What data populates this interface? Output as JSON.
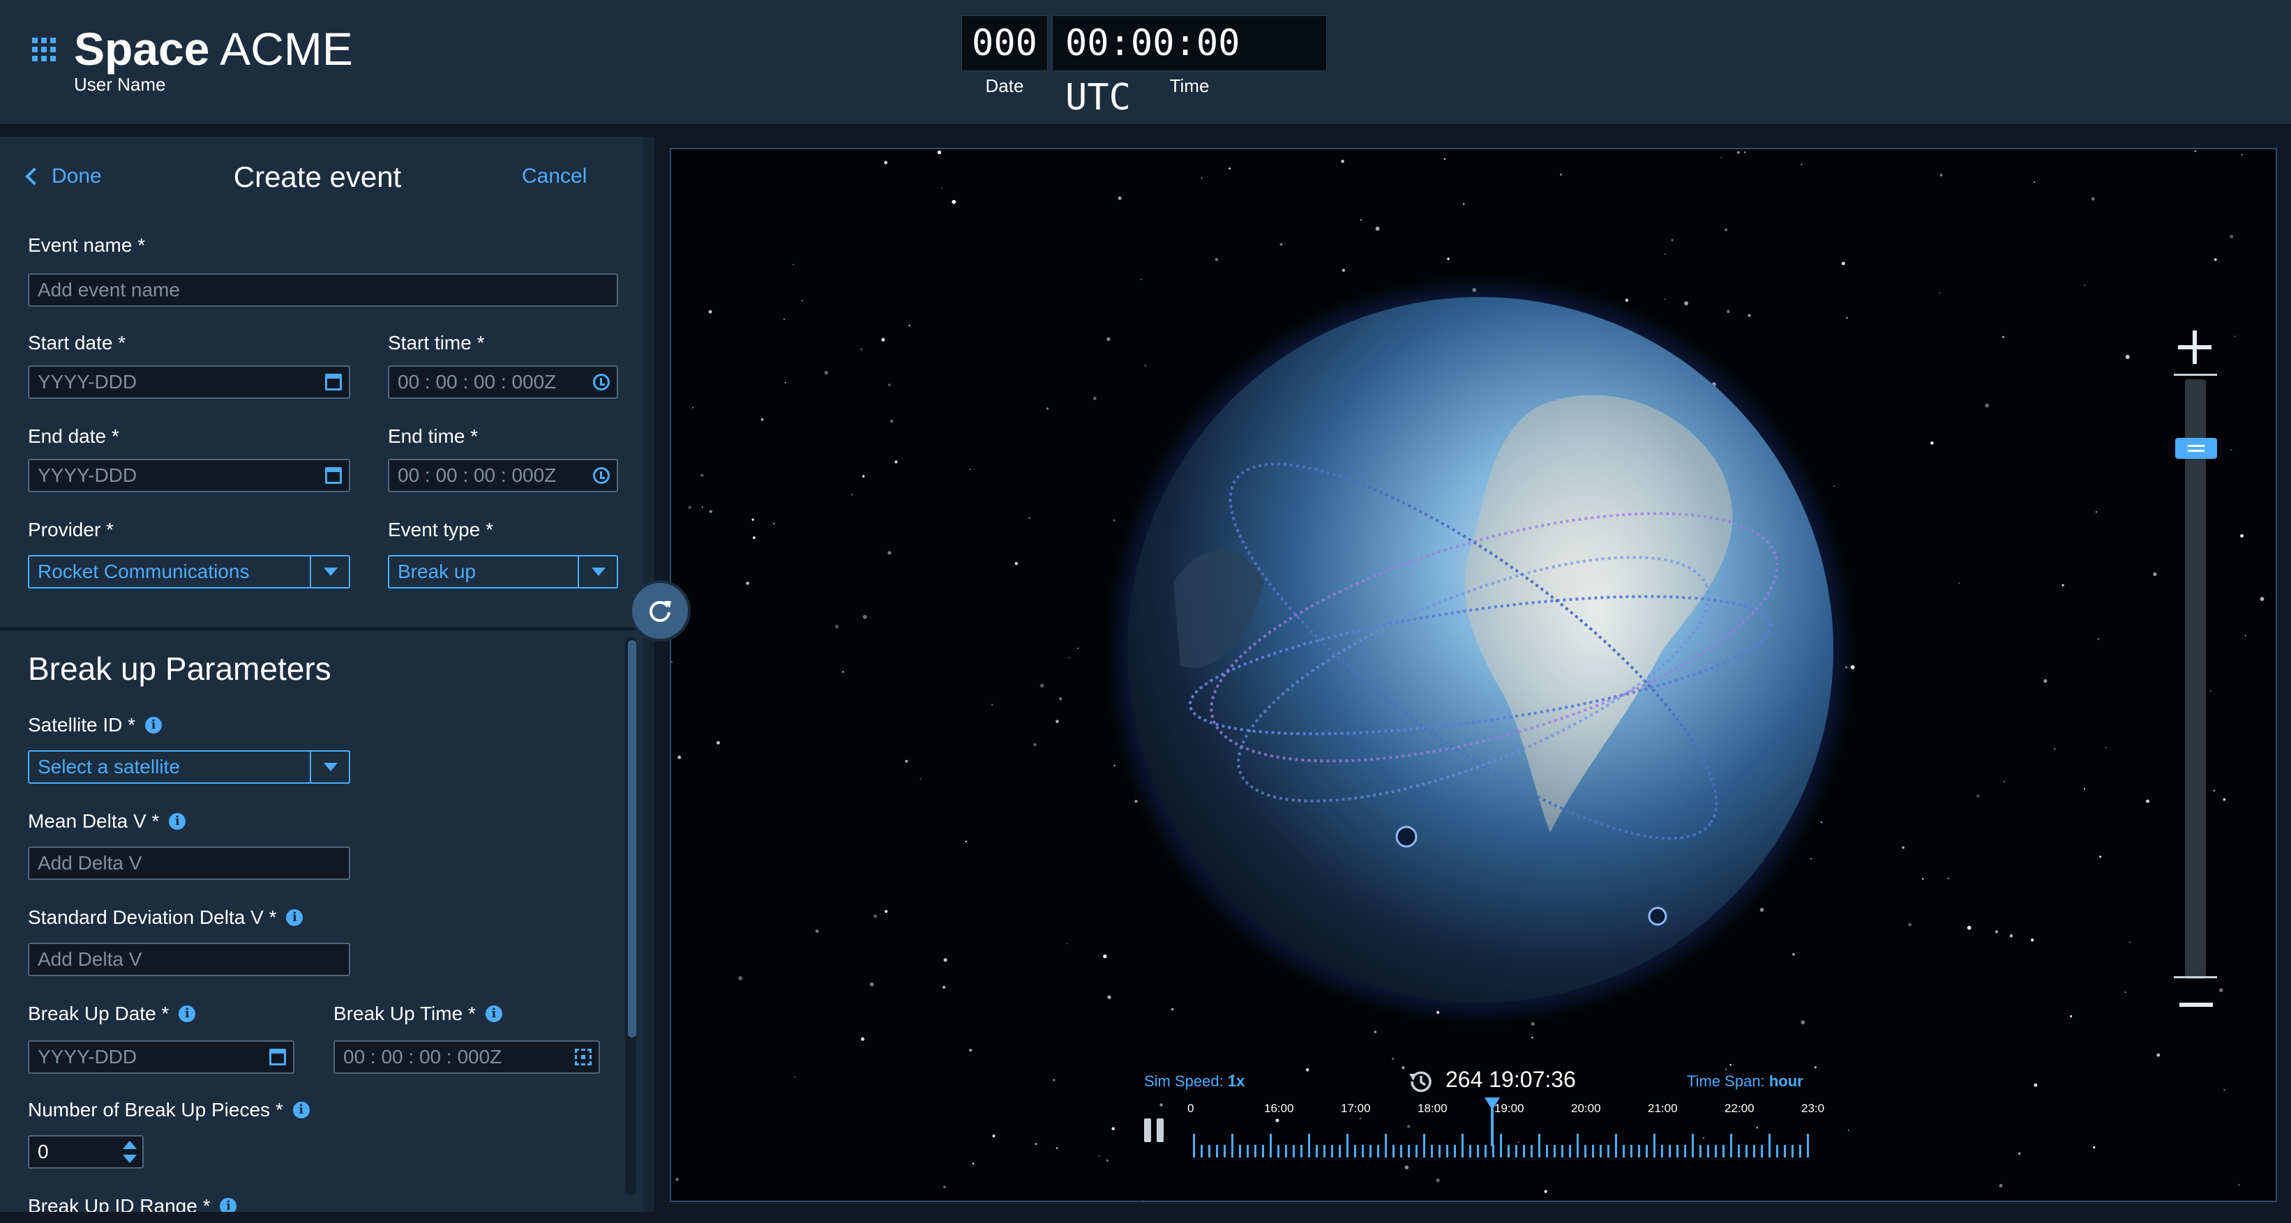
{
  "app": {
    "title_bold": "Space",
    "title_regular": "ACME",
    "user": "User Name"
  },
  "clock": {
    "date": "000",
    "time": "00:00:00 UTC",
    "date_label": "Date",
    "time_label": "Time"
  },
  "panel": {
    "done_label": "Done",
    "title": "Create event",
    "cancel_label": "Cancel",
    "event_name": {
      "label": "Event name *",
      "placeholder": "Add event name"
    },
    "start_date": {
      "label": "Start date *",
      "placeholder": "YYYY-DDD"
    },
    "start_time": {
      "label": "Start time *",
      "placeholder": "00 : 00 : 00 : 000Z"
    },
    "end_date": {
      "label": "End date *",
      "placeholder": "YYYY-DDD"
    },
    "end_time": {
      "label": "End time *",
      "placeholder": "00 : 00 : 00 : 000Z"
    },
    "provider": {
      "label": "Provider *",
      "value": "Rocket Communications"
    },
    "event_type": {
      "label": "Event type *",
      "value": "Break up"
    }
  },
  "breakup": {
    "title": "Break up Parameters",
    "satellite_id": {
      "label": "Satellite ID *",
      "value": "Select a satellite"
    },
    "mean_delta_v": {
      "label": "Mean Delta V *",
      "placeholder": "Add Delta V"
    },
    "std_delta_v": {
      "label": "Standard Deviation Delta V *",
      "placeholder": "Add Delta V"
    },
    "breakup_date": {
      "label": "Break Up Date *",
      "placeholder": "YYYY-DDD"
    },
    "breakup_time": {
      "label": "Break Up Time *",
      "placeholder": "00 : 00 : 00 : 000Z"
    },
    "pieces": {
      "label": "Number of Break Up Pieces *",
      "value": "0"
    },
    "id_range": {
      "label": "Break Up ID Range *"
    }
  },
  "timeline": {
    "sim_speed_label": "Sim Speed:",
    "sim_speed_value": "1x",
    "current_time": "264 19:07:36",
    "time_span_label": "Time Span:",
    "time_span_value": "hour",
    "ticks": [
      "0",
      "16:00",
      "17:00",
      "18:00",
      "19:00",
      "20:00",
      "21:00",
      "22:00",
      "23:0"
    ]
  },
  "icons": {
    "apps": "grid-icon",
    "back": "chevron-left-icon",
    "calendar": "calendar-icon",
    "clock": "clock-icon",
    "info": "info-icon",
    "history": "history-icon",
    "pause": "pause-icon",
    "refresh": "refresh-icon",
    "zoom_in": "plus-icon",
    "zoom_out": "minus-icon"
  },
  "colors": {
    "accent": "#4dacff",
    "panel": "#1b2d3e",
    "background": "#101923",
    "orbit": "#5a7fd6",
    "orbit_alt": "#a07be0"
  }
}
